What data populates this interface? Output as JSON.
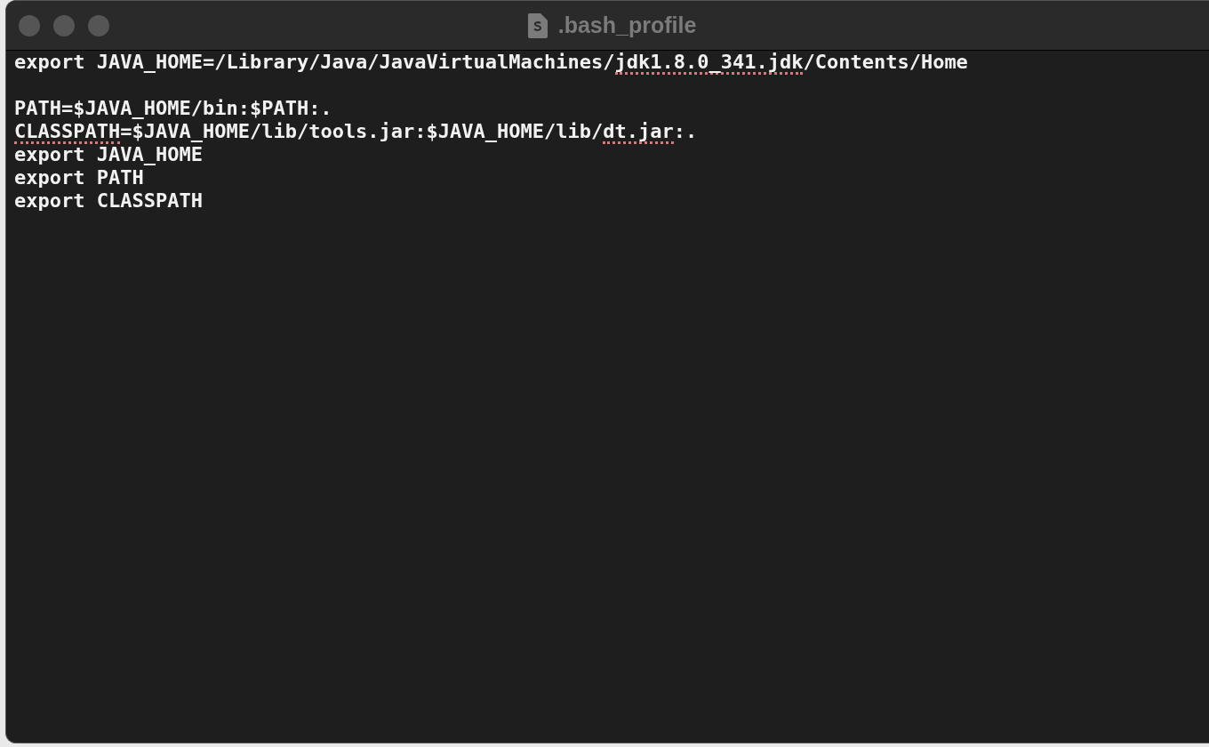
{
  "window": {
    "title": ".bash_profile"
  },
  "editor": {
    "lines": [
      {
        "kind": "text",
        "segments": [
          {
            "text": "export JAVA_HOME=/Library/Java/JavaVirtualMachines/",
            "misspelled": false
          },
          {
            "text": "jdk1.8.0_341.jdk",
            "misspelled": true
          },
          {
            "text": "/Contents/Home",
            "misspelled": false
          }
        ]
      },
      {
        "kind": "blank"
      },
      {
        "kind": "text",
        "segments": [
          {
            "text": "PATH=$JAVA_HOME/bin:$PATH:.",
            "misspelled": false
          }
        ]
      },
      {
        "kind": "text",
        "segments": [
          {
            "text": "CLASSPATH",
            "misspelled": true
          },
          {
            "text": "=$JAVA_HOME/lib/tools.jar:$JAVA_HOME/lib/",
            "misspelled": false
          },
          {
            "text": "dt.jar",
            "misspelled": true
          },
          {
            "text": ":.",
            "misspelled": false
          }
        ]
      },
      {
        "kind": "text",
        "segments": [
          {
            "text": "export JAVA_HOME",
            "misspelled": false
          }
        ]
      },
      {
        "kind": "text",
        "segments": [
          {
            "text": "export PATH",
            "misspelled": false
          }
        ]
      },
      {
        "kind": "text",
        "segments": [
          {
            "text": "export CLASSPATH",
            "misspelled": false
          }
        ]
      }
    ]
  }
}
